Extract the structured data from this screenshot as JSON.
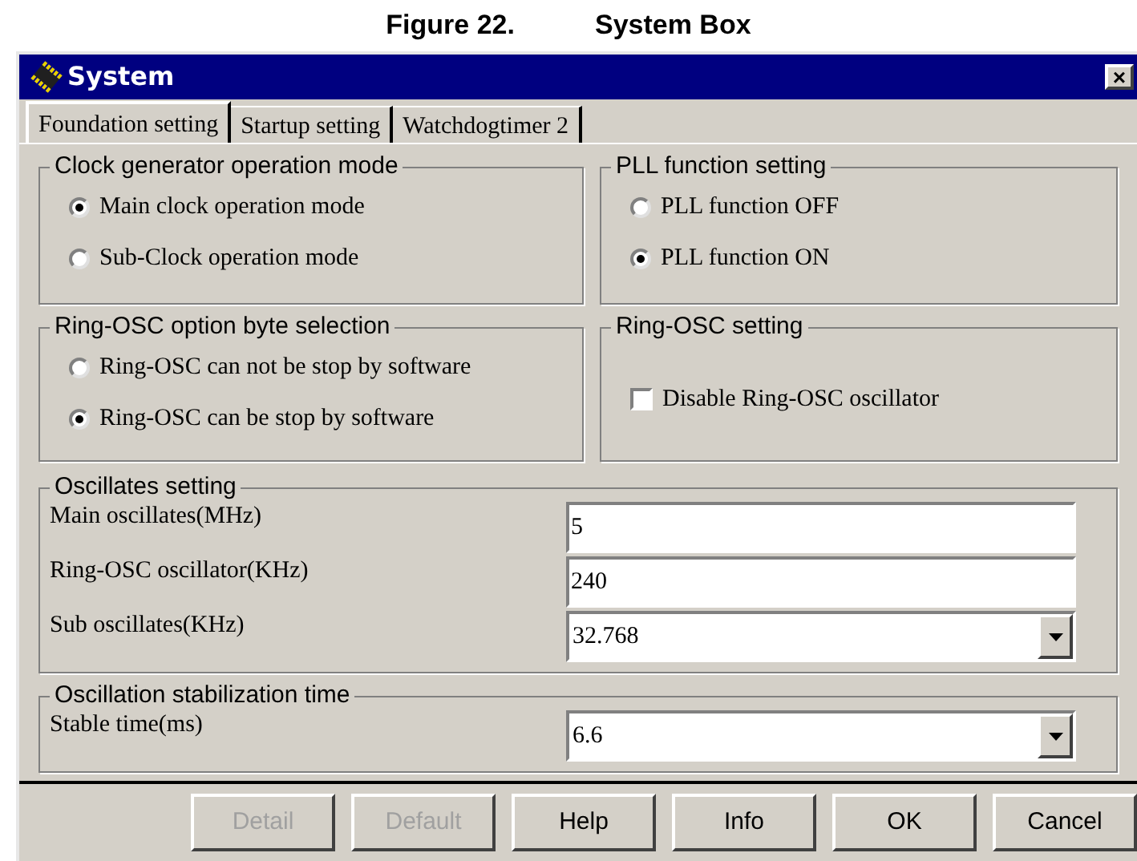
{
  "caption": {
    "figure": "Figure 22.",
    "title": "System Box"
  },
  "window": {
    "title": "System",
    "close": "×"
  },
  "tabs": [
    {
      "label": "Foundation setting",
      "selected": true
    },
    {
      "label": "Startup setting",
      "selected": false
    },
    {
      "label": "Watchdogtimer 2",
      "selected": false
    }
  ],
  "groups": [
    {
      "kind": "radio",
      "title": "Clock generator operation mode",
      "options": [
        {
          "label": "Main clock operation mode",
          "selected": true
        },
        {
          "label": "Sub-Clock operation mode",
          "selected": false
        }
      ]
    },
    {
      "kind": "radio",
      "title": "PLL function setting",
      "options": [
        {
          "label": "PLL function OFF",
          "selected": false
        },
        {
          "label": "PLL function ON",
          "selected": true
        }
      ]
    },
    {
      "kind": "radio",
      "title": "Ring-OSC option byte selection",
      "options": [
        {
          "label": "Ring-OSC can not be stop by software",
          "selected": false
        },
        {
          "label": "Ring-OSC can be stop by software",
          "selected": true
        }
      ]
    },
    {
      "kind": "checkbox",
      "title": "Ring-OSC setting",
      "options": [
        {
          "label": "Disable Ring-OSC oscillator",
          "checked": false
        }
      ]
    }
  ],
  "field_groups": [
    {
      "title": "Oscillates setting",
      "fields": [
        {
          "kind": "text",
          "label": "Main oscillates(MHz)",
          "value": "5"
        },
        {
          "kind": "text",
          "label": "Ring-OSC oscillator(KHz)",
          "value": "240"
        },
        {
          "kind": "dropdown",
          "label": "Sub oscillates(KHz)",
          "value": "32.768"
        }
      ]
    },
    {
      "title": "Oscillation stabilization time",
      "fields": [
        {
          "kind": "dropdown",
          "label": "Stable time(ms)",
          "value": "6.6"
        }
      ]
    }
  ],
  "buttons": [
    {
      "label": "Detail",
      "disabled": true
    },
    {
      "label": "Default",
      "disabled": true
    },
    {
      "label": "Help",
      "disabled": false
    },
    {
      "label": "Info",
      "disabled": false
    },
    {
      "label": "OK",
      "disabled": false
    },
    {
      "label": "Cancel",
      "disabled": false
    }
  ]
}
